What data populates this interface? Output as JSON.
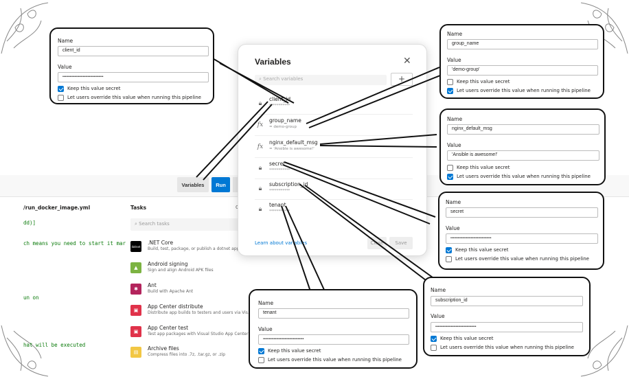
{
  "toolbar": {
    "variables_label": "Variables",
    "run_label": "Run"
  },
  "editor": {
    "filename": "/run_docker_image.yml",
    "lines": [
      "dd)]",
      "ch means you need to start it mar",
      "un on",
      "hat will be executed"
    ]
  },
  "tasks": {
    "title": "Tasks",
    "header_extra": "C",
    "search_placeholder": "Search tasks",
    "items": [
      {
        "name": ".NET Core",
        "desc": "Build, test, package, or publish a dotnet applica...",
        "icon": "dotnet-icon",
        "icon_text": "dotnet",
        "color": "#000000"
      },
      {
        "name": "Android signing",
        "desc": "Sign and align Android APK files",
        "icon": "android-icon",
        "icon_text": "",
        "color": "#7cb342"
      },
      {
        "name": "Ant",
        "desc": "Build with Apache Ant",
        "icon": "ant-icon",
        "icon_text": "",
        "color": "#b3245c"
      },
      {
        "name": "App Center distribute",
        "desc": "Distribute app builds to testers and users via Vis...",
        "icon": "app-center-icon",
        "icon_text": "",
        "color": "#e0324a"
      },
      {
        "name": "App Center test",
        "desc": "Test app packages with Visual Studio App Center",
        "icon": "app-center-test-icon",
        "icon_text": "",
        "color": "#e0324a"
      },
      {
        "name": "Archive files",
        "desc": "Compress files into .7z, .tar.gz, or .zip",
        "icon": "archive-icon",
        "icon_text": "",
        "color": "#f2c744"
      }
    ]
  },
  "variables_panel": {
    "title": "Variables",
    "search_placeholder": "Search variables",
    "learn_link": "Learn about variables",
    "close_label": "Close",
    "save_label": "Save",
    "items": [
      {
        "name": "client_id",
        "sub": "***********",
        "icon": "lock-icon"
      },
      {
        "name": "group_name",
        "sub": "= demo-group",
        "icon": "fx-icon"
      },
      {
        "name": "nginx_default_msg",
        "sub": "= 'Ansible is awesome!'",
        "icon": "fx-icon"
      },
      {
        "name": "secret",
        "sub": "***********",
        "icon": "lock-icon"
      },
      {
        "name": "subscription_id",
        "sub": "***********",
        "icon": "lock-icon"
      },
      {
        "name": "tenant",
        "sub": "***********",
        "icon": "lock-icon"
      }
    ]
  },
  "callouts": {
    "name_label": "Name",
    "value_label": "Value",
    "keep_secret_label": "Keep this value secret",
    "override_label": "Let users override this value when running this pipeline",
    "client_id": {
      "name": "client_id",
      "value": "••••••••••••••••••••••••••••••••••",
      "secret": true,
      "override": false
    },
    "group_name": {
      "name": "group_name",
      "value": "'demo-group'",
      "secret": false,
      "override": true
    },
    "nginx_default_msg": {
      "name": "nginx_default_msg",
      "value": "'Ansible is awesome!'",
      "secret": false,
      "override": true
    },
    "secret": {
      "name": "secret",
      "value": "••••••••••••••••••••••••••••••••••",
      "secret": true,
      "override": false
    },
    "subscription_id": {
      "name": "subscription_id",
      "value": "••••••••••••••••••••••••••••••••••",
      "secret": true,
      "override": false
    },
    "tenant": {
      "name": "tenant",
      "value": "••••••••••••••••••••••••••••••••••",
      "secret": true,
      "override": false
    }
  },
  "colors": {
    "accent": "#0078d4",
    "code": "#0a7a0a",
    "callout_border": "#111111"
  }
}
